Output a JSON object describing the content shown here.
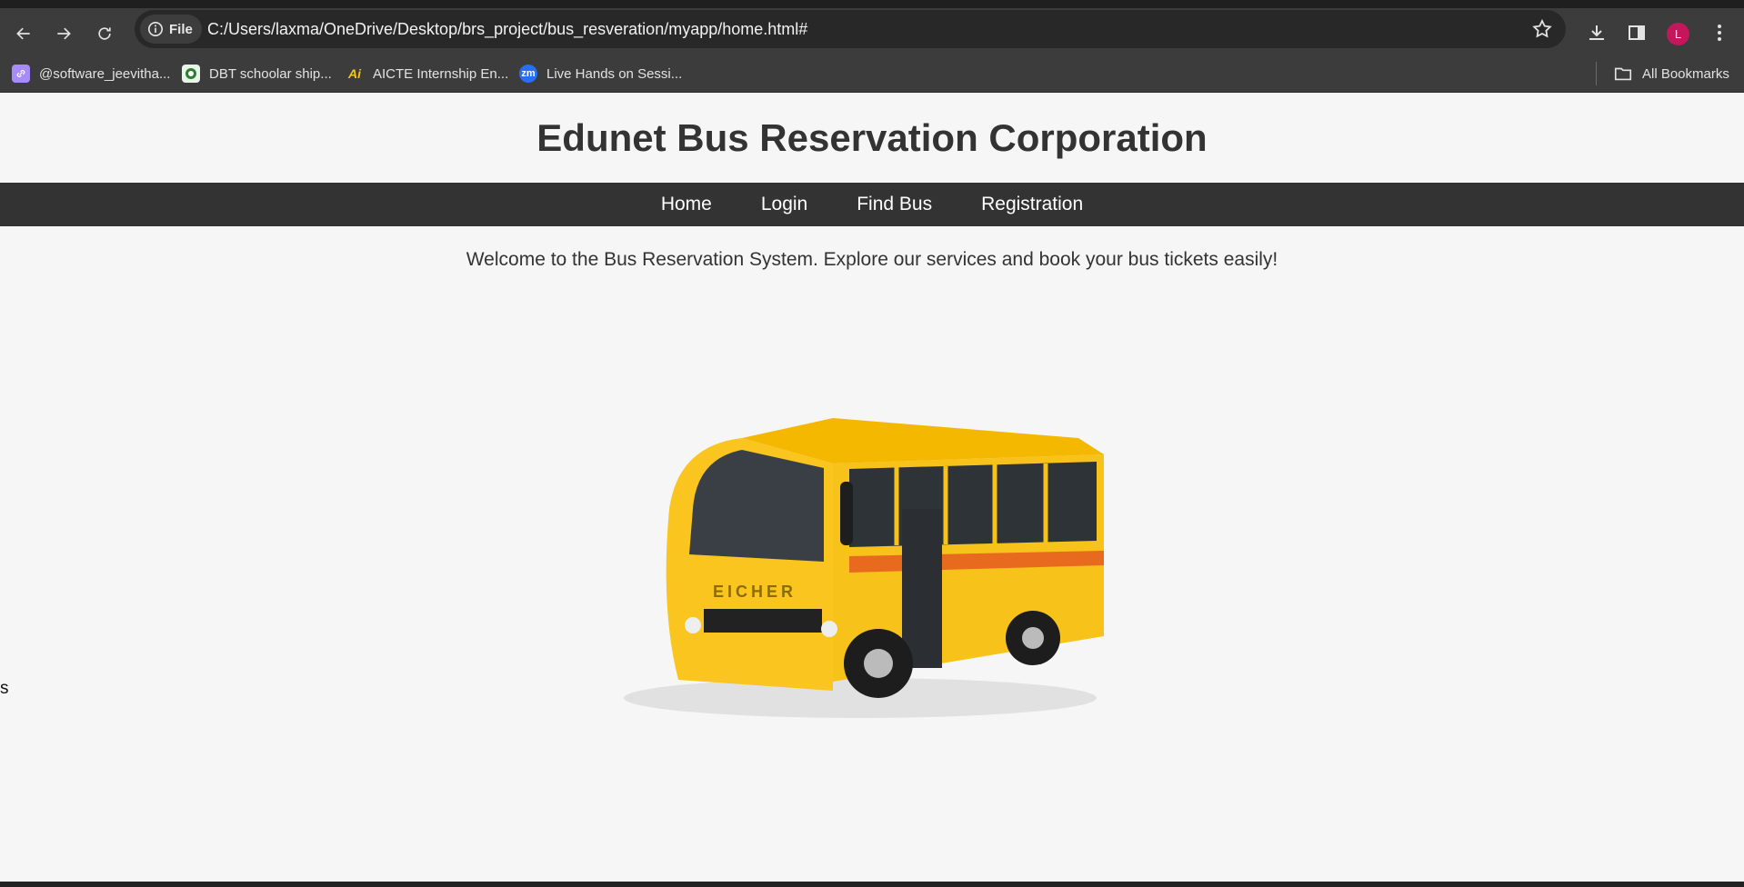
{
  "browser": {
    "site_chip": "File",
    "url": "C:/Users/laxma/OneDrive/Desktop/brs_project/bus_resveration/myapp/home.html#",
    "profile_initial": "L",
    "bookmarks": [
      {
        "label": "@software_jeevitha...",
        "icon": "link-icon",
        "color": "#a78bfa"
      },
      {
        "label": "DBT schoolar ship...",
        "icon": "emblem-icon",
        "color": "#e8f5e9"
      },
      {
        "label": "AICTE Internship En...",
        "icon": "aicte-icon",
        "color": "#2b2b2b"
      },
      {
        "label": "Live Hands on Sessi...",
        "icon": "zoom-icon",
        "color": "#2d6cf6",
        "text": "zm"
      }
    ],
    "all_bookmarks_label": "All Bookmarks"
  },
  "site": {
    "title": "Edunet Bus Reservation Corporation",
    "nav": [
      "Home",
      "Login",
      "Find Bus",
      "Registration"
    ],
    "welcome": "Welcome to the Bus Reservation System. Explore our services and book your bus tickets easily!",
    "bus_brand": "EICHER",
    "stray_text": "s"
  }
}
